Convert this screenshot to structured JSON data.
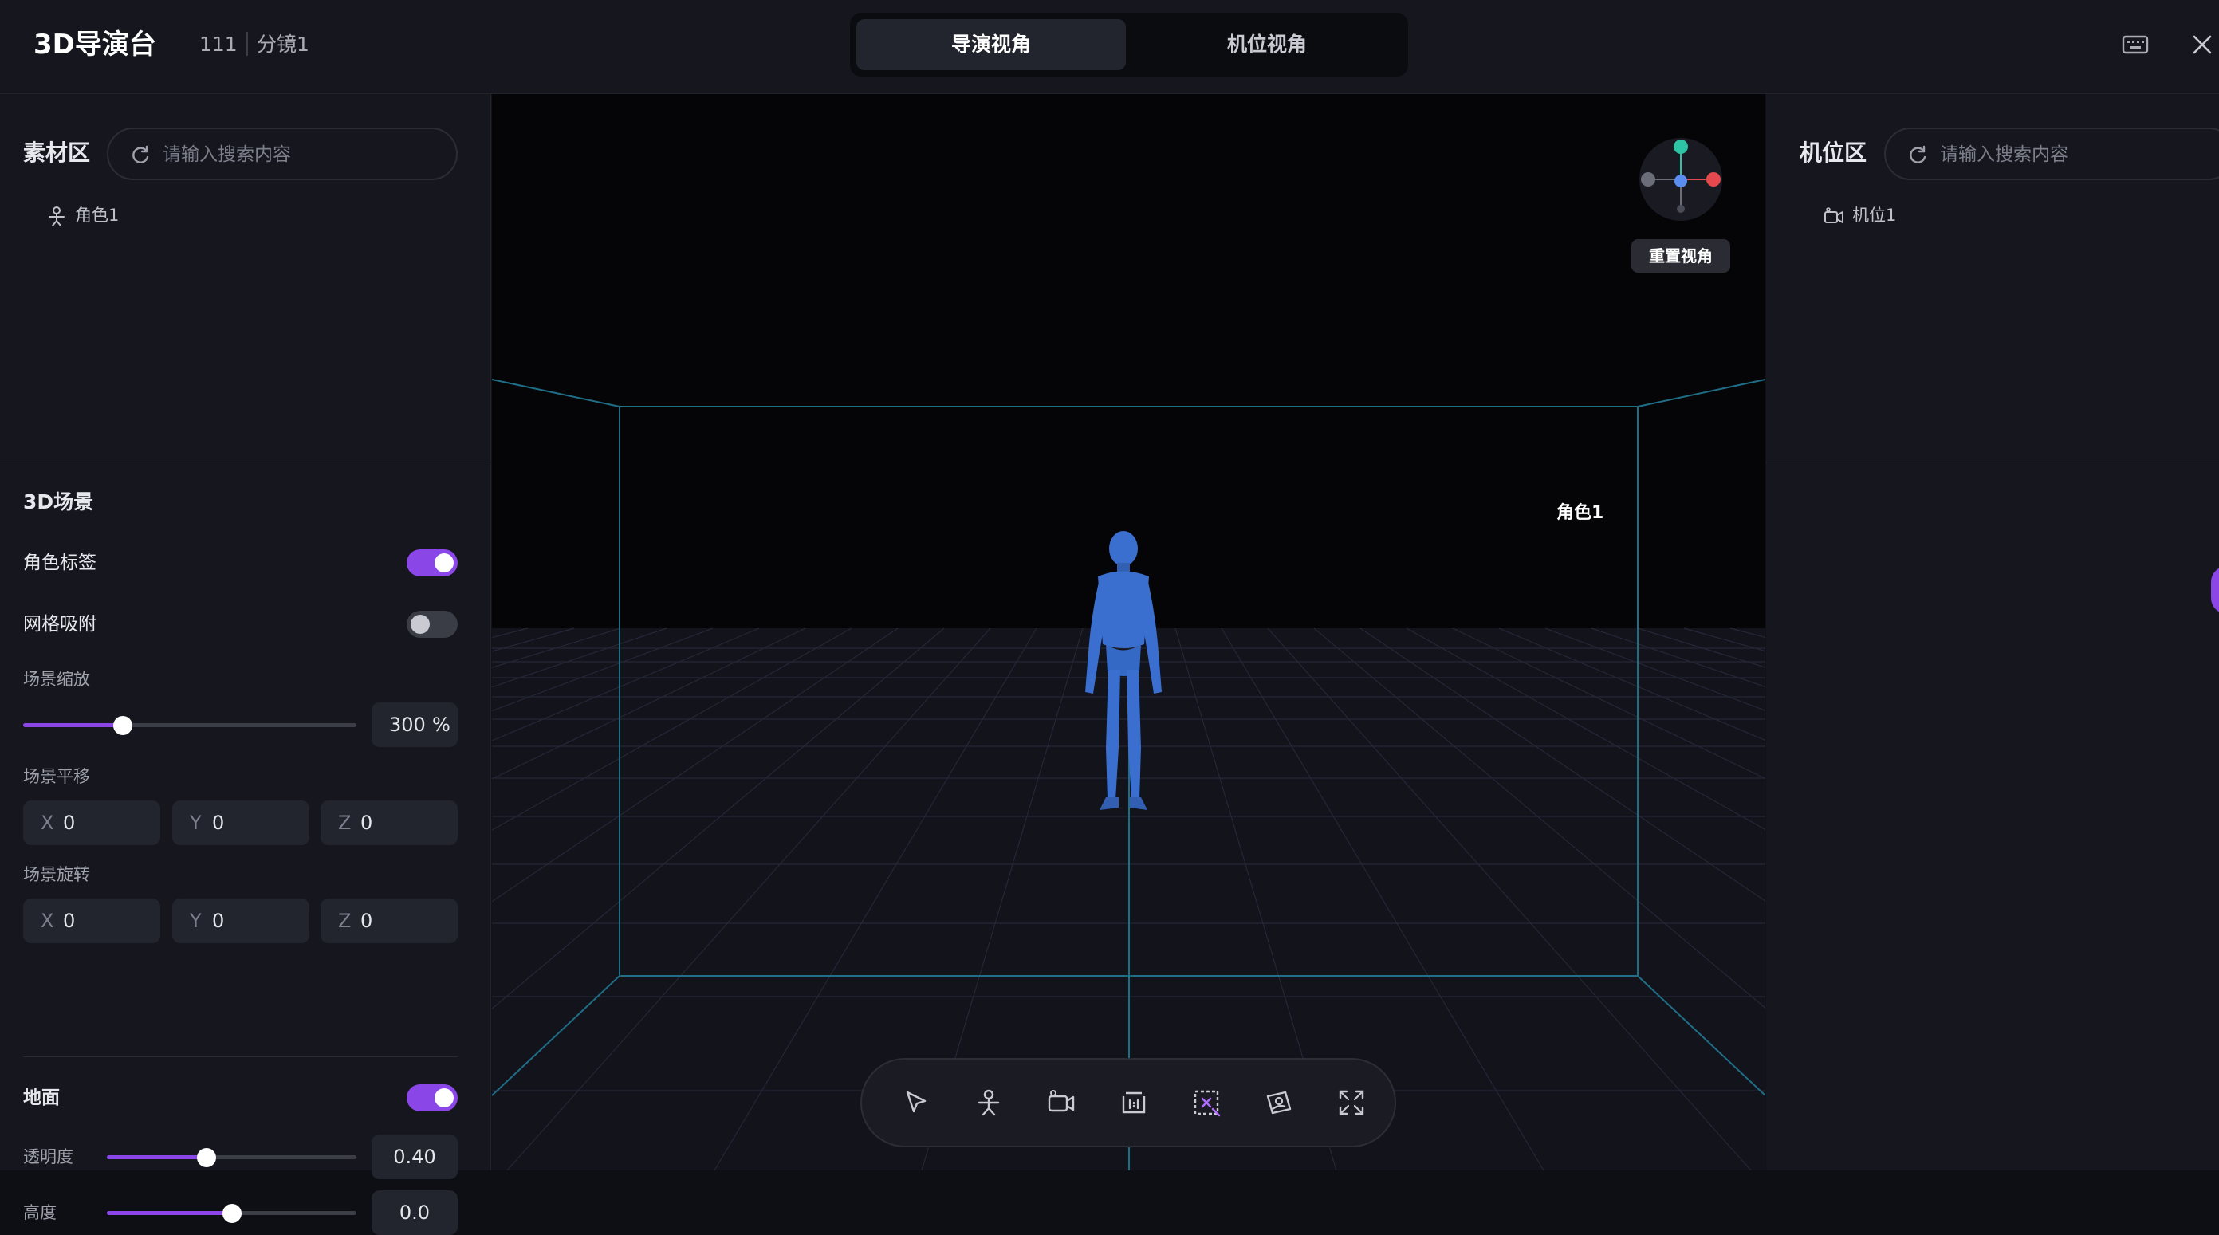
{
  "header": {
    "app_title": "3D导演台",
    "project": "111",
    "shot": "分镜1",
    "tabs": [
      {
        "label": "导演视角",
        "active": true
      },
      {
        "label": "机位视角",
        "active": false
      }
    ],
    "icons": [
      "keyboard-icon",
      "close-icon"
    ]
  },
  "left": {
    "assets_title": "素材区",
    "search_placeholder": "请输入搜索内容",
    "assets": [
      {
        "label": "角色1",
        "icon": "character-icon"
      }
    ],
    "scene_title": "3D场景",
    "role_label": {
      "label": "角色标签",
      "on": true
    },
    "grid_snap": {
      "label": "网格吸附",
      "on": false
    },
    "scene_scale": {
      "label": "场景缩放",
      "value": "300",
      "unit": "%",
      "level": 0.3
    },
    "scene_translate": {
      "label": "场景平移",
      "x": "0",
      "y": "0",
      "z": "0"
    },
    "scene_rotate": {
      "label": "场景旋转",
      "x": "0",
      "y": "0",
      "z": "0"
    },
    "axis_labels": {
      "x": "X",
      "y": "Y",
      "z": "Z"
    },
    "ground": {
      "label": "地面",
      "on": true
    },
    "opacity": {
      "label": "透明度",
      "value": "0.40",
      "level": 0.4
    },
    "height": {
      "label": "高度",
      "value": "0.0",
      "level": 0.5
    }
  },
  "viewport": {
    "reset_view_label": "重置视角",
    "character_label": "角色1",
    "gizmo_colors": {
      "x": "#e5484d",
      "y": "#2ec4a6",
      "z": "#5b8def",
      "neg": "#6b6e78"
    },
    "character_color": "#3a6fd0",
    "toolbar": [
      "select-icon",
      "add-character-icon",
      "add-camera-icon",
      "aspect-ratio-icon",
      "remove-selection-icon",
      "screenshot-icon",
      "fullscreen-icon"
    ]
  },
  "right": {
    "title": "机位区",
    "search_placeholder": "请输入搜索内容",
    "cameras": [
      {
        "label": "机位1",
        "icon": "camera-icon"
      }
    ]
  },
  "accent": "#8b46e8"
}
